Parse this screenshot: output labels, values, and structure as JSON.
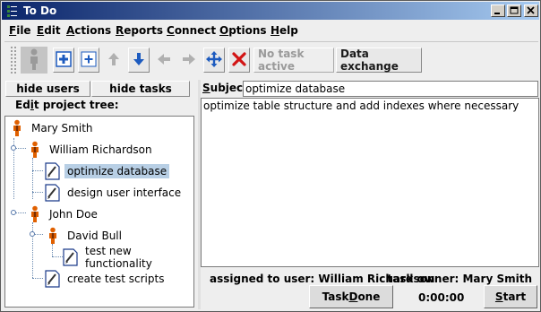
{
  "window": {
    "title": "To Do"
  },
  "menu": [
    {
      "label": "File",
      "mnemonic": "F",
      "rest": "ile"
    },
    {
      "label": "Edit",
      "mnemonic": "E",
      "rest": "dit"
    },
    {
      "label": "Actions",
      "mnemonic": "A",
      "rest": "ctions"
    },
    {
      "label": "Reports",
      "mnemonic": "R",
      "rest": "eports"
    },
    {
      "label": "Connect",
      "mnemonic": "C",
      "rest": "onnect"
    },
    {
      "label": "Options",
      "mnemonic": "O",
      "rest": "ptions"
    },
    {
      "label": "Help",
      "mnemonic": "H",
      "rest": "elp"
    }
  ],
  "toolbar": {
    "no_task_label": "No task active",
    "data_exchange_label": "Data exchange",
    "icons": [
      "person-icon",
      "add-user-icon",
      "add-task-icon",
      "move-up-icon",
      "move-down-icon",
      "move-left-icon",
      "move-right-icon",
      "move-icon",
      "delete-icon"
    ]
  },
  "left": {
    "hide_users": "hide users",
    "hide_tasks": "hide tasks",
    "tree_label_prefix": "Ed",
    "tree_label_mnemonic": "i",
    "tree_label_suffix": "t project tree:"
  },
  "tree": [
    {
      "label": "Mary Smith",
      "type": "user"
    },
    {
      "label": "William Richardson",
      "type": "user"
    },
    {
      "label": "optimize database",
      "type": "task",
      "selected": true
    },
    {
      "label": "design user interface",
      "type": "task"
    },
    {
      "label": "John Doe",
      "type": "user"
    },
    {
      "label": "David Bull",
      "type": "user"
    },
    {
      "label": "test new functionality",
      "type": "task"
    },
    {
      "label": "create test scripts",
      "type": "task"
    }
  ],
  "right": {
    "subject_prefix": "S",
    "subject_suffix": "ubject:",
    "subject_value": "optimize database",
    "description": "optimize table structure and add indexes where necessary",
    "assigned_label": "assigned to user: William Richardson",
    "owner_label": "task owner: Mary Smith",
    "task_done_prefix": "Task ",
    "task_done_mnemonic": "D",
    "task_done_suffix": "one",
    "timer": "0:00:00",
    "start_mnemonic": "S",
    "start_suffix": "tart"
  },
  "colors": {
    "selection": "#b8cfe5",
    "user_icon": "#e06000",
    "title_start": "#0a246a"
  }
}
